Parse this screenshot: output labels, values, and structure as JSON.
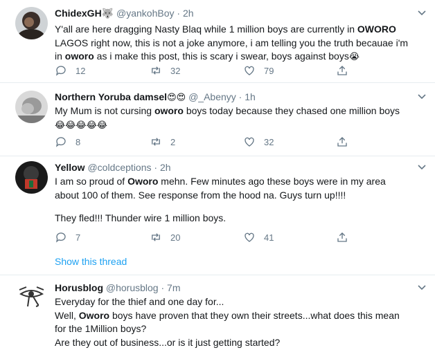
{
  "tweets": [
    {
      "name": "ChidexGH🐺",
      "handle": "@yankohBoy",
      "dot": "·",
      "time": "2h",
      "lines": [
        [
          "Y'all are here dragging Nasty Blaq while 1 million boys are currently in ",
          "OWORO"
        ],
        [
          " LAGOS right now, this is not a joke anymore, i am telling you the truth becauae i'm"
        ],
        [
          "in ",
          "oworo",
          " as i make this post, this is scary i swear, boys against boys",
          "😭"
        ]
      ],
      "replies": "12",
      "retweets": "32",
      "likes": "79"
    },
    {
      "name": "Northern Yoruba damsel",
      "name_emoji": "😍😍",
      "handle": "@_Abenyy",
      "dot": "·",
      "time": "1h",
      "lines": [
        [
          "My Mum is not cursing ",
          "oworo",
          " boys today because they chased one million boys"
        ],
        [
          "😂😂😂😂😂"
        ]
      ],
      "replies": "8",
      "retweets": "2",
      "likes": "32"
    },
    {
      "name": "Yellow",
      "handle": "@coldceptions",
      "dot": "·",
      "time": "2h",
      "lines": [
        [
          "I am so proud of ",
          "Oworo",
          " mehn.  Few minutes ago these boys were in my area"
        ],
        [
          "about 100 of them. See response from the hood na. Guys turn up!!!!"
        ],
        [
          ""
        ],
        [
          "They fled!!! Thunder wire 1 million boys."
        ]
      ],
      "replies": "7",
      "retweets": "20",
      "likes": "41",
      "show_thread": "Show this thread"
    },
    {
      "name": "Horusblog",
      "handle": "@horusblog",
      "dot": "·",
      "time": "7m",
      "lines": [
        [
          "Everyday for the thief and one day for..."
        ],
        [
          "Well, ",
          "Oworo",
          " boys have proven that they own their streets...what does this mean"
        ],
        [
          "for the 1Million boys?"
        ],
        [
          "Are they out of business...or is it just getting started?"
        ]
      ]
    }
  ],
  "colors": {
    "accent": "#1da1f2",
    "muted": "#657786",
    "text": "#14171a",
    "divider": "#e6ecf0"
  },
  "icons": [
    "reply-icon",
    "retweet-icon",
    "like-icon",
    "share-icon",
    "chevron-down-icon"
  ]
}
